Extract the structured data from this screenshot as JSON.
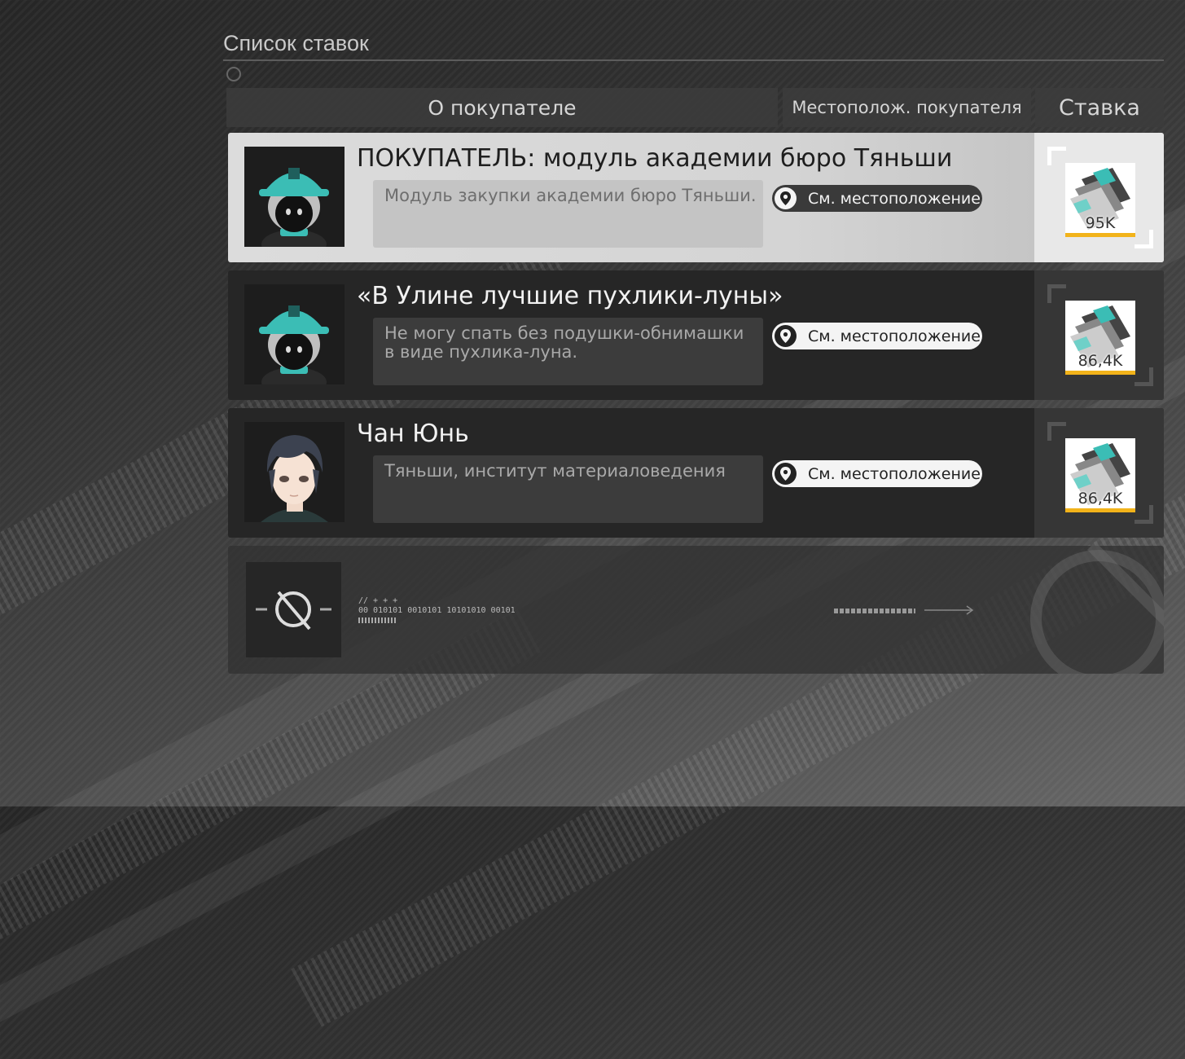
{
  "header": {
    "title": "Список ставок",
    "columns": {
      "about": "О покупателе",
      "location": "Местополож. покупателя",
      "bid": "Ставка"
    }
  },
  "rows": [
    {
      "name": "ПОКУПАТЕЛЬ: модуль академии бюро Тяньши",
      "description": "Модуль закупки академии бюро Тяньши.",
      "location_label": "См. местоположение",
      "bid": "95K",
      "avatar": "robot-helmet-avatar",
      "selected": true
    },
    {
      "name": "«В Улине лучшие пухлики-луны»",
      "description": "Не могу спать без подушки-обнимашки в виде пухлика-луна.",
      "location_label": "См. местоположение",
      "bid": "86,4K",
      "avatar": "robot-helmet-avatar",
      "selected": false
    },
    {
      "name": "Чан Юнь",
      "description": "Тяньши, институт материаловедения",
      "location_label": "См. местоположение",
      "bid": "86,4K",
      "avatar": "character-portrait-avatar",
      "selected": false
    }
  ],
  "empty_slot": {
    "code_line1": "// + + +",
    "code_line2": "00 010101 0010101 10101010     00101"
  },
  "colors": {
    "accent_gold": "#f2b31a",
    "helmet_teal": "#3bbdb5",
    "selected_row": "#d8d8d8",
    "row_dark": "#262626"
  }
}
